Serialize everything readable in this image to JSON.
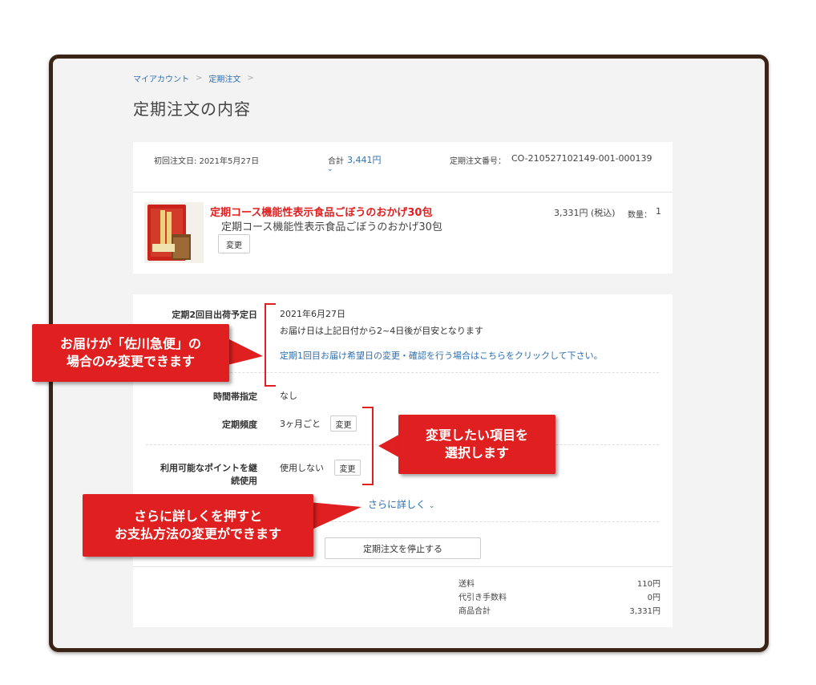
{
  "breadcrumb": {
    "home": "マイアカウント",
    "sep": ">",
    "current": "定期注文",
    "sep2": ">"
  },
  "page_title": "定期注文の内容",
  "summary": {
    "first_order_label": "初回注文日: 2021年5月27日",
    "total_label": "合計",
    "total_value": "3,441円",
    "order_no_label": "定期注文番号：",
    "order_no_value": "CO-210527102149-001-000139"
  },
  "product": {
    "title_red": "定期コース機能性表示食品ごぼうのおかげ30包",
    "title": "定期コース機能性表示食品ごぼうのおかげ30包",
    "change_button": "変更",
    "price": "3,331円 (税込)",
    "qty_label": "数量：",
    "qty_value": "1"
  },
  "details": {
    "ship_label": "定期2回目出荷予定日",
    "ship_date": "2021年6月27日",
    "ship_note": "お届け日は上記日付から2~4日後が目安となります",
    "ship_link": "定期1回目お届け希望日の変更・確認を行う場合はこちらをクリックして下さい。",
    "time_label": "時間帯指定",
    "time_value": "なし",
    "freq_label": "定期頻度",
    "freq_value": "3ヶ月ごと",
    "freq_change": "変更",
    "points_label_1": "利用可能なポイントを継",
    "points_label_2": "続使用",
    "points_value": "使用しない",
    "points_change": "変更",
    "more_link": "さらに詳しく",
    "stop_button": "定期注文を停止する"
  },
  "totals": [
    {
      "label": "送料",
      "value": "110円"
    },
    {
      "label": "代引き手数料",
      "value": "0円"
    },
    {
      "label": "商品合計",
      "value": "3,331円"
    }
  ],
  "callouts": {
    "sagawa_1": "お届けが「佐川急便」の",
    "sagawa_2": "場合のみ変更できます",
    "select_1": "変更したい項目を",
    "select_2": "選択します",
    "more_1": "さらに詳しくを押すと",
    "more_2": "お支払方法の変更ができます"
  },
  "colors": {
    "accent_red": "#e02020",
    "link_blue": "#2f6fb0",
    "frame_brown": "#3b2316"
  }
}
